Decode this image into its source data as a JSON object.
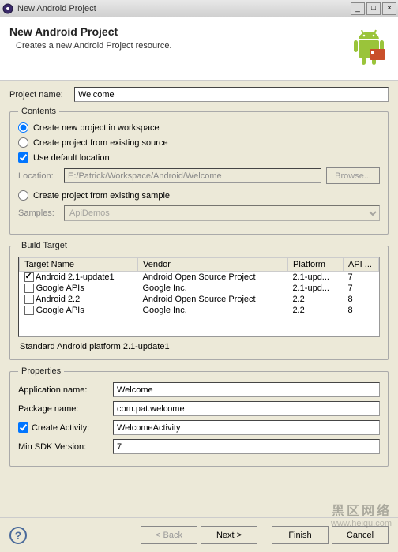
{
  "window": {
    "title": "New Android Project",
    "min": "_",
    "max": "□",
    "close": "×"
  },
  "header": {
    "title": "New Android Project",
    "subtitle": "Creates a new Android Project resource."
  },
  "project_name": {
    "label": "Project name:",
    "value": "Welcome"
  },
  "contents": {
    "legend": "Contents",
    "opt_new": "Create new project in workspace",
    "opt_existing": "Create project from existing source",
    "use_default": "Use default location",
    "location_label": "Location:",
    "location_value": "E:/Patrick/Workspace/Android/Welcome",
    "browse": "Browse...",
    "opt_sample": "Create project from existing sample",
    "samples_label": "Samples:",
    "samples_value": "ApiDemos"
  },
  "build_target": {
    "legend": "Build Target",
    "cols": {
      "name": "Target Name",
      "vendor": "Vendor",
      "platform": "Platform",
      "api": "API ..."
    },
    "rows": [
      {
        "checked": true,
        "name": "Android 2.1-update1",
        "vendor": "Android Open Source Project",
        "platform": "2.1-upd...",
        "api": "7"
      },
      {
        "checked": false,
        "name": "Google APIs",
        "vendor": "Google Inc.",
        "platform": "2.1-upd...",
        "api": "7"
      },
      {
        "checked": false,
        "name": "Android 2.2",
        "vendor": "Android Open Source Project",
        "platform": "2.2",
        "api": "8"
      },
      {
        "checked": false,
        "name": "Google APIs",
        "vendor": "Google Inc.",
        "platform": "2.2",
        "api": "8"
      }
    ],
    "status": "Standard Android platform 2.1-update1"
  },
  "properties": {
    "legend": "Properties",
    "app_name_label": "Application name:",
    "app_name_value": "Welcome",
    "pkg_label": "Package name:",
    "pkg_value": "com.pat.welcome",
    "create_activity_label": "Create Activity:",
    "activity_value": "WelcomeActivity",
    "min_sdk_label": "Min SDK Version:",
    "min_sdk_value": "7"
  },
  "footer": {
    "back": "< Back",
    "next": "Next >",
    "finish": "Finish",
    "cancel": "Cancel"
  },
  "watermark": {
    "line1": "黑区网络",
    "line2": "www.heiqu.com"
  }
}
